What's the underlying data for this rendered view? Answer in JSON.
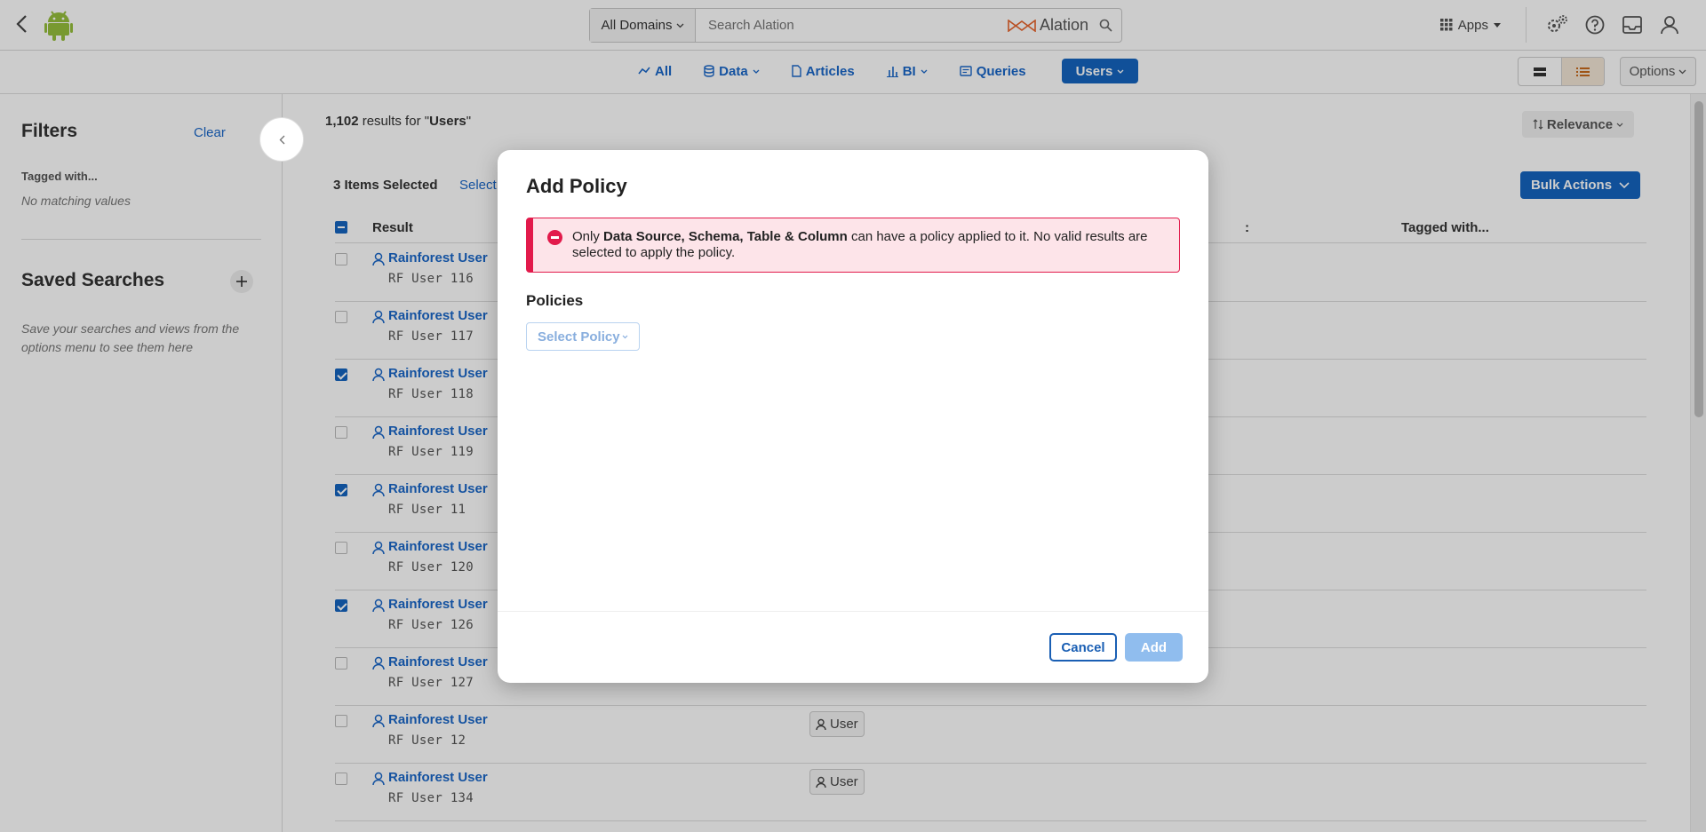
{
  "header": {
    "domains_label": "All Domains",
    "search_placeholder": "Search Alation",
    "logo_text": "Alation",
    "apps_label": "Apps"
  },
  "nav": {
    "tabs": [
      {
        "label": "All",
        "icon": "trend-icon"
      },
      {
        "label": "Data",
        "icon": "database-icon"
      },
      {
        "label": "Articles",
        "icon": "document-icon"
      },
      {
        "label": "BI",
        "icon": "bar-chart-icon"
      },
      {
        "label": "Queries",
        "icon": "query-icon"
      },
      {
        "label": "Users",
        "icon": "",
        "active": true
      }
    ],
    "options_label": "Options"
  },
  "sidebar": {
    "filters_title": "Filters",
    "clear_label": "Clear",
    "tagged_label": "Tagged with...",
    "no_matching": "No matching values",
    "saved_title": "Saved Searches",
    "saved_hint": "Save your searches and views from the options menu to see them here"
  },
  "results": {
    "count": "1,102",
    "count_text": " results for \"",
    "query": "Users",
    "query_close": "\"",
    "sort_label": "Relevance",
    "selected_label": "3 Items Selected",
    "select_link": "Select",
    "bulk_label": "Bulk Actions",
    "columns": {
      "result": "Result",
      "col3": ":",
      "tagged": "Tagged with..."
    },
    "rows": [
      {
        "name": "Rainforest User",
        "sub": "RF User 116",
        "checked": false,
        "tag": ""
      },
      {
        "name": "Rainforest User",
        "sub": "RF User 117",
        "checked": false,
        "tag": ""
      },
      {
        "name": "Rainforest User",
        "sub": "RF User 118",
        "checked": true,
        "tag": ""
      },
      {
        "name": "Rainforest User",
        "sub": "RF User 119",
        "checked": false,
        "tag": ""
      },
      {
        "name": "Rainforest User",
        "sub": "RF User 11",
        "checked": true,
        "tag": ""
      },
      {
        "name": "Rainforest User",
        "sub": "RF User 120",
        "checked": false,
        "tag": ""
      },
      {
        "name": "Rainforest User",
        "sub": "RF User 126",
        "checked": true,
        "tag": ""
      },
      {
        "name": "Rainforest User",
        "sub": "RF User 127",
        "checked": false,
        "tag": ""
      },
      {
        "name": "Rainforest User",
        "sub": "RF User 12",
        "checked": false,
        "tag": "User"
      },
      {
        "name": "Rainforest User",
        "sub": "RF User 134",
        "checked": false,
        "tag": "User"
      }
    ]
  },
  "modal": {
    "title": "Add Policy",
    "alert_pre": "Only ",
    "alert_bold": "Data Source, Schema, Table & Column",
    "alert_post": " can have a policy applied to it. No valid results are selected to apply the policy.",
    "policies_label": "Policies",
    "select_policy": "Select Policy",
    "cancel_label": "Cancel",
    "add_label": "Add"
  },
  "colors": {
    "accent": "#1565c0",
    "link": "#1a67c9",
    "error": "#e21a4b",
    "error_bg": "#fde4e9",
    "disabled_btn": "#90bdee"
  }
}
